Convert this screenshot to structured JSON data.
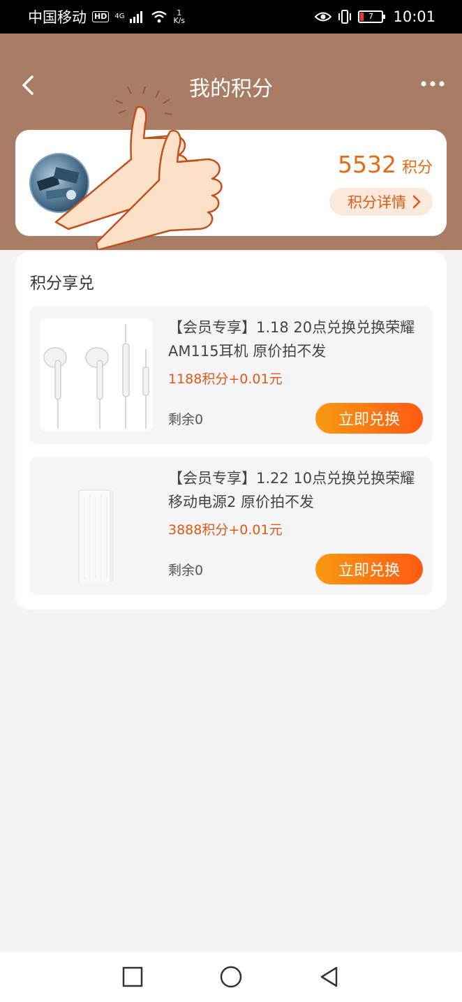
{
  "status_bar": {
    "carrier": "中国移动",
    "hd": "HD",
    "network": "4G",
    "speed_value": "1",
    "speed_unit": "K/s",
    "battery": "7",
    "time": "10:01"
  },
  "header": {
    "title": "我的积分",
    "colors": {
      "background": "#a97c66",
      "accent": "#e76a13"
    }
  },
  "profile": {
    "points": "5532",
    "points_unit": "积分",
    "detail_label": "积分详情"
  },
  "exchange": {
    "title": "积分享兑",
    "products": [
      {
        "name": "【会员专享】1.18 20点兑换兑换荣耀AM115耳机 原价拍不发",
        "price": "1188积分+0.01元",
        "stock": "剩余0",
        "button": "立即兑换",
        "image_icon": "earphones-image"
      },
      {
        "name": "【会员专享】1.22 10点兑换兑换荣耀移动电源2 原价拍不发",
        "price": "3888积分+0.01元",
        "stock": "剩余0",
        "button": "立即兑换",
        "image_icon": "power-bank-image"
      }
    ]
  },
  "bottom_nav": {
    "icons": [
      "recent-apps-icon",
      "home-icon",
      "back-icon"
    ]
  }
}
